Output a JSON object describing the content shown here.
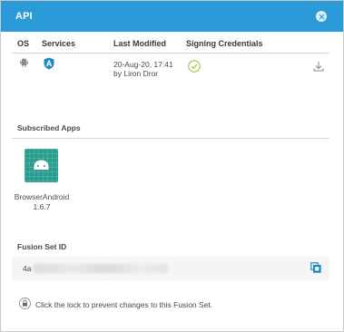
{
  "dialog": {
    "title": "API"
  },
  "table": {
    "headers": {
      "os": "OS",
      "services": "Services",
      "modified": "Last Modified",
      "credentials": "Signing Credentials"
    },
    "rows": [
      {
        "os_icon": "android-icon",
        "service_icon": "shield-icon",
        "modified_date": "20-Aug-20, 17:41",
        "modified_by": "by Liron Dror",
        "credential_icon": "check-circle-icon",
        "action_icon": "download-icon"
      }
    ]
  },
  "subscribed": {
    "title": "Subscribed Apps",
    "apps": [
      {
        "name": "BrowserAndroid 1.6.7",
        "icon": "android-icon",
        "tile_color": "#2a9d8f"
      }
    ]
  },
  "fusion": {
    "title": "Fusion Set ID",
    "id_visible_prefix": "4a",
    "copy_icon": "copy-icon"
  },
  "footer": {
    "lock_icon": "lock-icon",
    "lock_text": "Click the lock to prevent changes to this Fusion Set."
  },
  "colors": {
    "header": "#2b9ad8",
    "service": "#1e88c7",
    "check": "#9bc53d",
    "tile": "#2a9d8f"
  }
}
